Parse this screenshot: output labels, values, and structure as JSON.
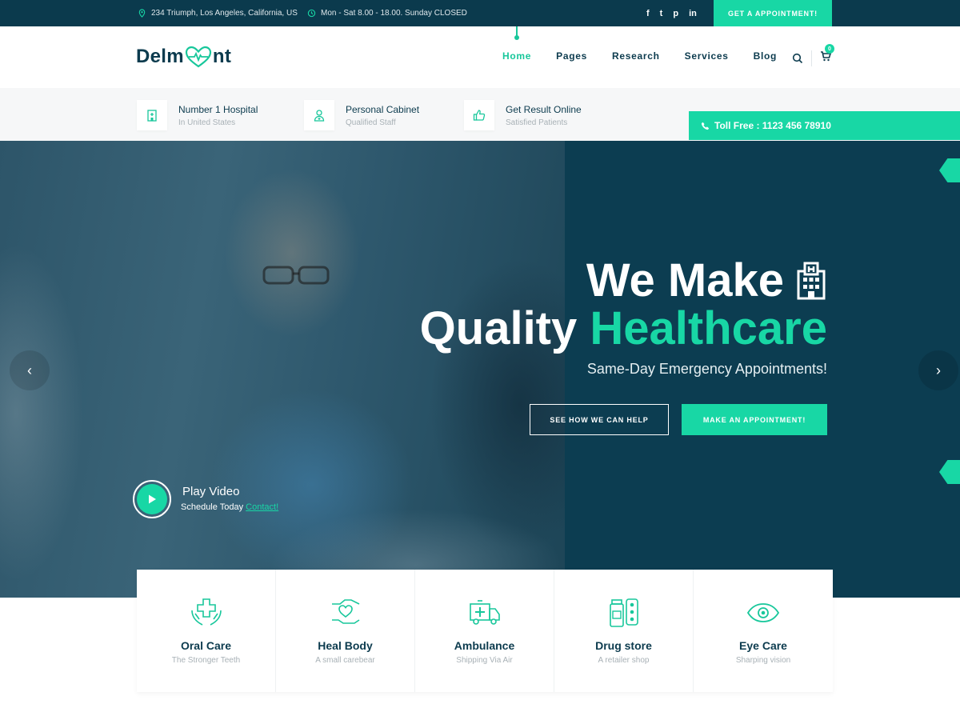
{
  "topbar": {
    "address": "234 Triumph, Los Angeles, California, US",
    "hours": "Mon - Sat 8.00 - 18.00. Sunday CLOSED",
    "socials": [
      "f",
      "t",
      "p",
      "in"
    ],
    "appointment_label": "GET A APPOINTMENT!"
  },
  "header": {
    "logo_left": "Delm",
    "logo_right": "nt",
    "nav": [
      "Home",
      "Pages",
      "Research",
      "Services",
      "Blog"
    ],
    "active_nav": "Home",
    "cart_count": "0"
  },
  "features": [
    {
      "title": "Number 1 Hospital",
      "subtitle": "In United States",
      "icon": "hospital-icon"
    },
    {
      "title": "Personal Cabinet",
      "subtitle": "Qualified Staff",
      "icon": "doctor-icon"
    },
    {
      "title": "Get Result Online",
      "subtitle": "Satisfied Patients",
      "icon": "thumbs-up-icon"
    }
  ],
  "toll_free": "Toll Free : 1123 456 78910",
  "hero": {
    "line1": "We Make",
    "line2_plain": "Quality",
    "line2_accent": "Healthcare",
    "subline": "Same-Day Emergency Appointments!",
    "btn_outline": "SEE HOW WE CAN HELP",
    "btn_fill": "MAKE AN APPOINTMENT!",
    "play_title": "Play Video",
    "play_sub": "Schedule Today",
    "play_link": "Contact!"
  },
  "services": [
    {
      "title": "Oral Care",
      "subtitle": "The Stronger Teeth",
      "icon": "hands-cross-icon"
    },
    {
      "title": "Heal Body",
      "subtitle": "A small carebear",
      "icon": "hand-heart-icon"
    },
    {
      "title": "Ambulance",
      "subtitle": "Shipping Via Air",
      "icon": "ambulance-icon"
    },
    {
      "title": "Drug store",
      "subtitle": "A retailer shop",
      "icon": "pills-icon"
    },
    {
      "title": "Eye Care",
      "subtitle": "Sharping vision",
      "icon": "eye-icon"
    }
  ],
  "colors": {
    "navy": "#0b3a4d",
    "accent": "#18d7a5",
    "muted": "#a8b1b6"
  }
}
